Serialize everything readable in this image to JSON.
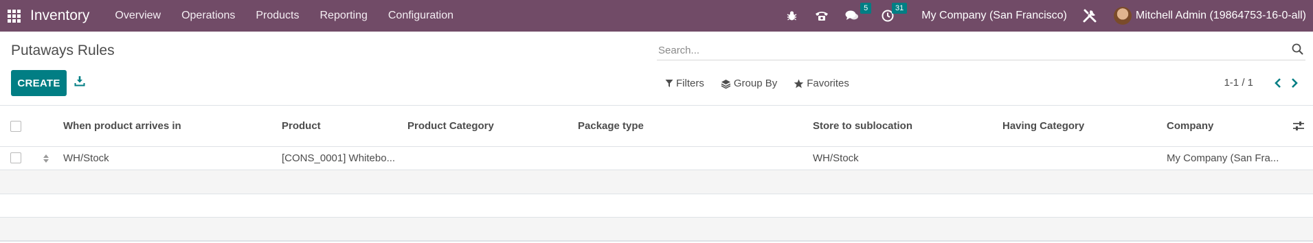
{
  "navbar": {
    "app_title": "Inventory",
    "menu": [
      "Overview",
      "Operations",
      "Products",
      "Reporting",
      "Configuration"
    ],
    "messages_count": "5",
    "activities_count": "31",
    "company": "My Company (San Francisco)",
    "user": "Mitchell Admin (19864753-16-0-all)",
    "icons": [
      "apps-grid-icon",
      "bug-icon",
      "phone-icon",
      "chat-icon",
      "clock-icon",
      "tools-icon"
    ]
  },
  "control_panel": {
    "title": "Putaways Rules",
    "create_label": "CREATE",
    "search_placeholder": "Search...",
    "filters_label": "Filters",
    "group_by_label": "Group By",
    "favorites_label": "Favorites",
    "pager": "1-1 / 1"
  },
  "table": {
    "columns": [
      "When product arrives in",
      "Product",
      "Product Category",
      "Package type",
      "Store to sublocation",
      "Having Category",
      "Company"
    ],
    "rows": [
      {
        "location_in": "WH/Stock",
        "product": "[CONS_0001] Whitebo...",
        "product_category": "",
        "package_type": "",
        "store_to": "WH/Stock",
        "having_category": "",
        "company": "My Company (San Fra..."
      }
    ]
  },
  "colors": {
    "navbar": "#714b67",
    "primary": "#017e84",
    "text": "#4c4c4c"
  }
}
